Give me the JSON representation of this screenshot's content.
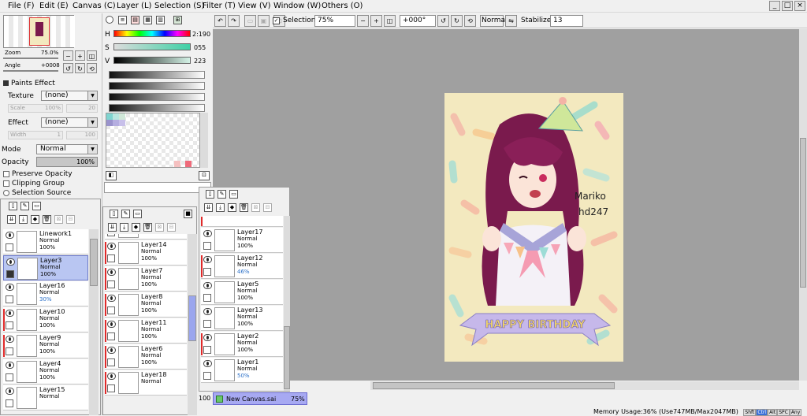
{
  "menu": [
    "File (F)",
    "Edit (E)",
    "Canvas (C)",
    "Layer (L)",
    "Selection (S)",
    "Filter (T)",
    "View (V)",
    "Window (W)",
    "Others (O)"
  ],
  "window_buttons": [
    "_",
    "□",
    "×"
  ],
  "toolbar": {
    "selection_label": "Selection",
    "zoom": "75%",
    "rotation": "+000°",
    "blend": "Normal",
    "stabilizer_label": "Stabilizer",
    "stabilizer_value": "13"
  },
  "navigator": {
    "zoom_label": "Zoom",
    "zoom_value": "75.0%",
    "angle_label": "Angle",
    "angle_value": "+0008"
  },
  "hsv": {
    "h_label": "H",
    "h_value": "2:190",
    "s_label": "S",
    "s_value": "055",
    "v_label": "V",
    "v_value": "223"
  },
  "paints_effect": {
    "title": "Paints Effect",
    "texture_label": "Texture",
    "texture_value": "(none)",
    "scale_label": "Scale",
    "scale_value": "100%",
    "scale_num": "20",
    "effect_label": "Effect",
    "effect_value": "(none)",
    "width_label": "Width",
    "width_value": "1",
    "width_num": "100"
  },
  "layer_props": {
    "mode_label": "Mode",
    "mode_value": "Normal",
    "opacity_label": "Opacity",
    "opacity_value": "100%",
    "preserve_opacity": "Preserve Opacity",
    "clipping_group": "Clipping Group",
    "selection_source": "Selection Source"
  },
  "layers_panel1": [
    {
      "name": "Linework1",
      "mode": "Normal",
      "opacity": "100%"
    },
    {
      "name": "Layer3",
      "mode": "Normal",
      "opacity": "100%"
    },
    {
      "name": "Layer16",
      "mode": "Normal",
      "opacity": "30%"
    },
    {
      "name": "Layer10",
      "mode": "Normal",
      "opacity": "100%"
    },
    {
      "name": "Layer9",
      "mode": "Normal",
      "opacity": "100%"
    },
    {
      "name": "Layer4",
      "mode": "Normal",
      "opacity": "100%"
    },
    {
      "name": "Layer15",
      "mode": "Normal",
      "opacity": ""
    }
  ],
  "layers_panel2": [
    {
      "name": "Layer13",
      "mode": "",
      "opacity": ""
    },
    {
      "name": "Layer14",
      "mode": "Normal",
      "opacity": "100%"
    },
    {
      "name": "Layer7",
      "mode": "Normal",
      "opacity": "100%"
    },
    {
      "name": "Layer8",
      "mode": "Normal",
      "opacity": "100%"
    },
    {
      "name": "Layer11",
      "mode": "Normal",
      "opacity": "100%"
    },
    {
      "name": "Layer6",
      "mode": "Normal",
      "opacity": "100%"
    },
    {
      "name": "Layer18",
      "mode": "Normal",
      "opacity": ""
    }
  ],
  "layers_panel3": [
    {
      "name": "Layer17",
      "mode": "Normal",
      "opacity": "100%"
    },
    {
      "name": "Layer12",
      "mode": "Normal",
      "opacity": "46%"
    },
    {
      "name": "Layer5",
      "mode": "Normal",
      "opacity": "100%"
    },
    {
      "name": "Layer13",
      "mode": "Normal",
      "opacity": "100%"
    },
    {
      "name": "Layer2",
      "mode": "Normal",
      "opacity": "100%"
    },
    {
      "name": "Layer1",
      "mode": "Normal",
      "opacity": "50%"
    }
  ],
  "panel_number": "100",
  "artwork": {
    "signature_line1": "Mariko",
    "signature_line2": "hd247",
    "banner": "HAPPY BIRTHDAY"
  },
  "document": {
    "name": "New Canvas.sai",
    "zoom": "75%"
  },
  "status": {
    "memory": "Memory Usage:36% (Use747MB/Max2047MB)",
    "keys": [
      "Shft",
      "Ctrl",
      "Alt",
      "SPC",
      "Any"
    ]
  }
}
